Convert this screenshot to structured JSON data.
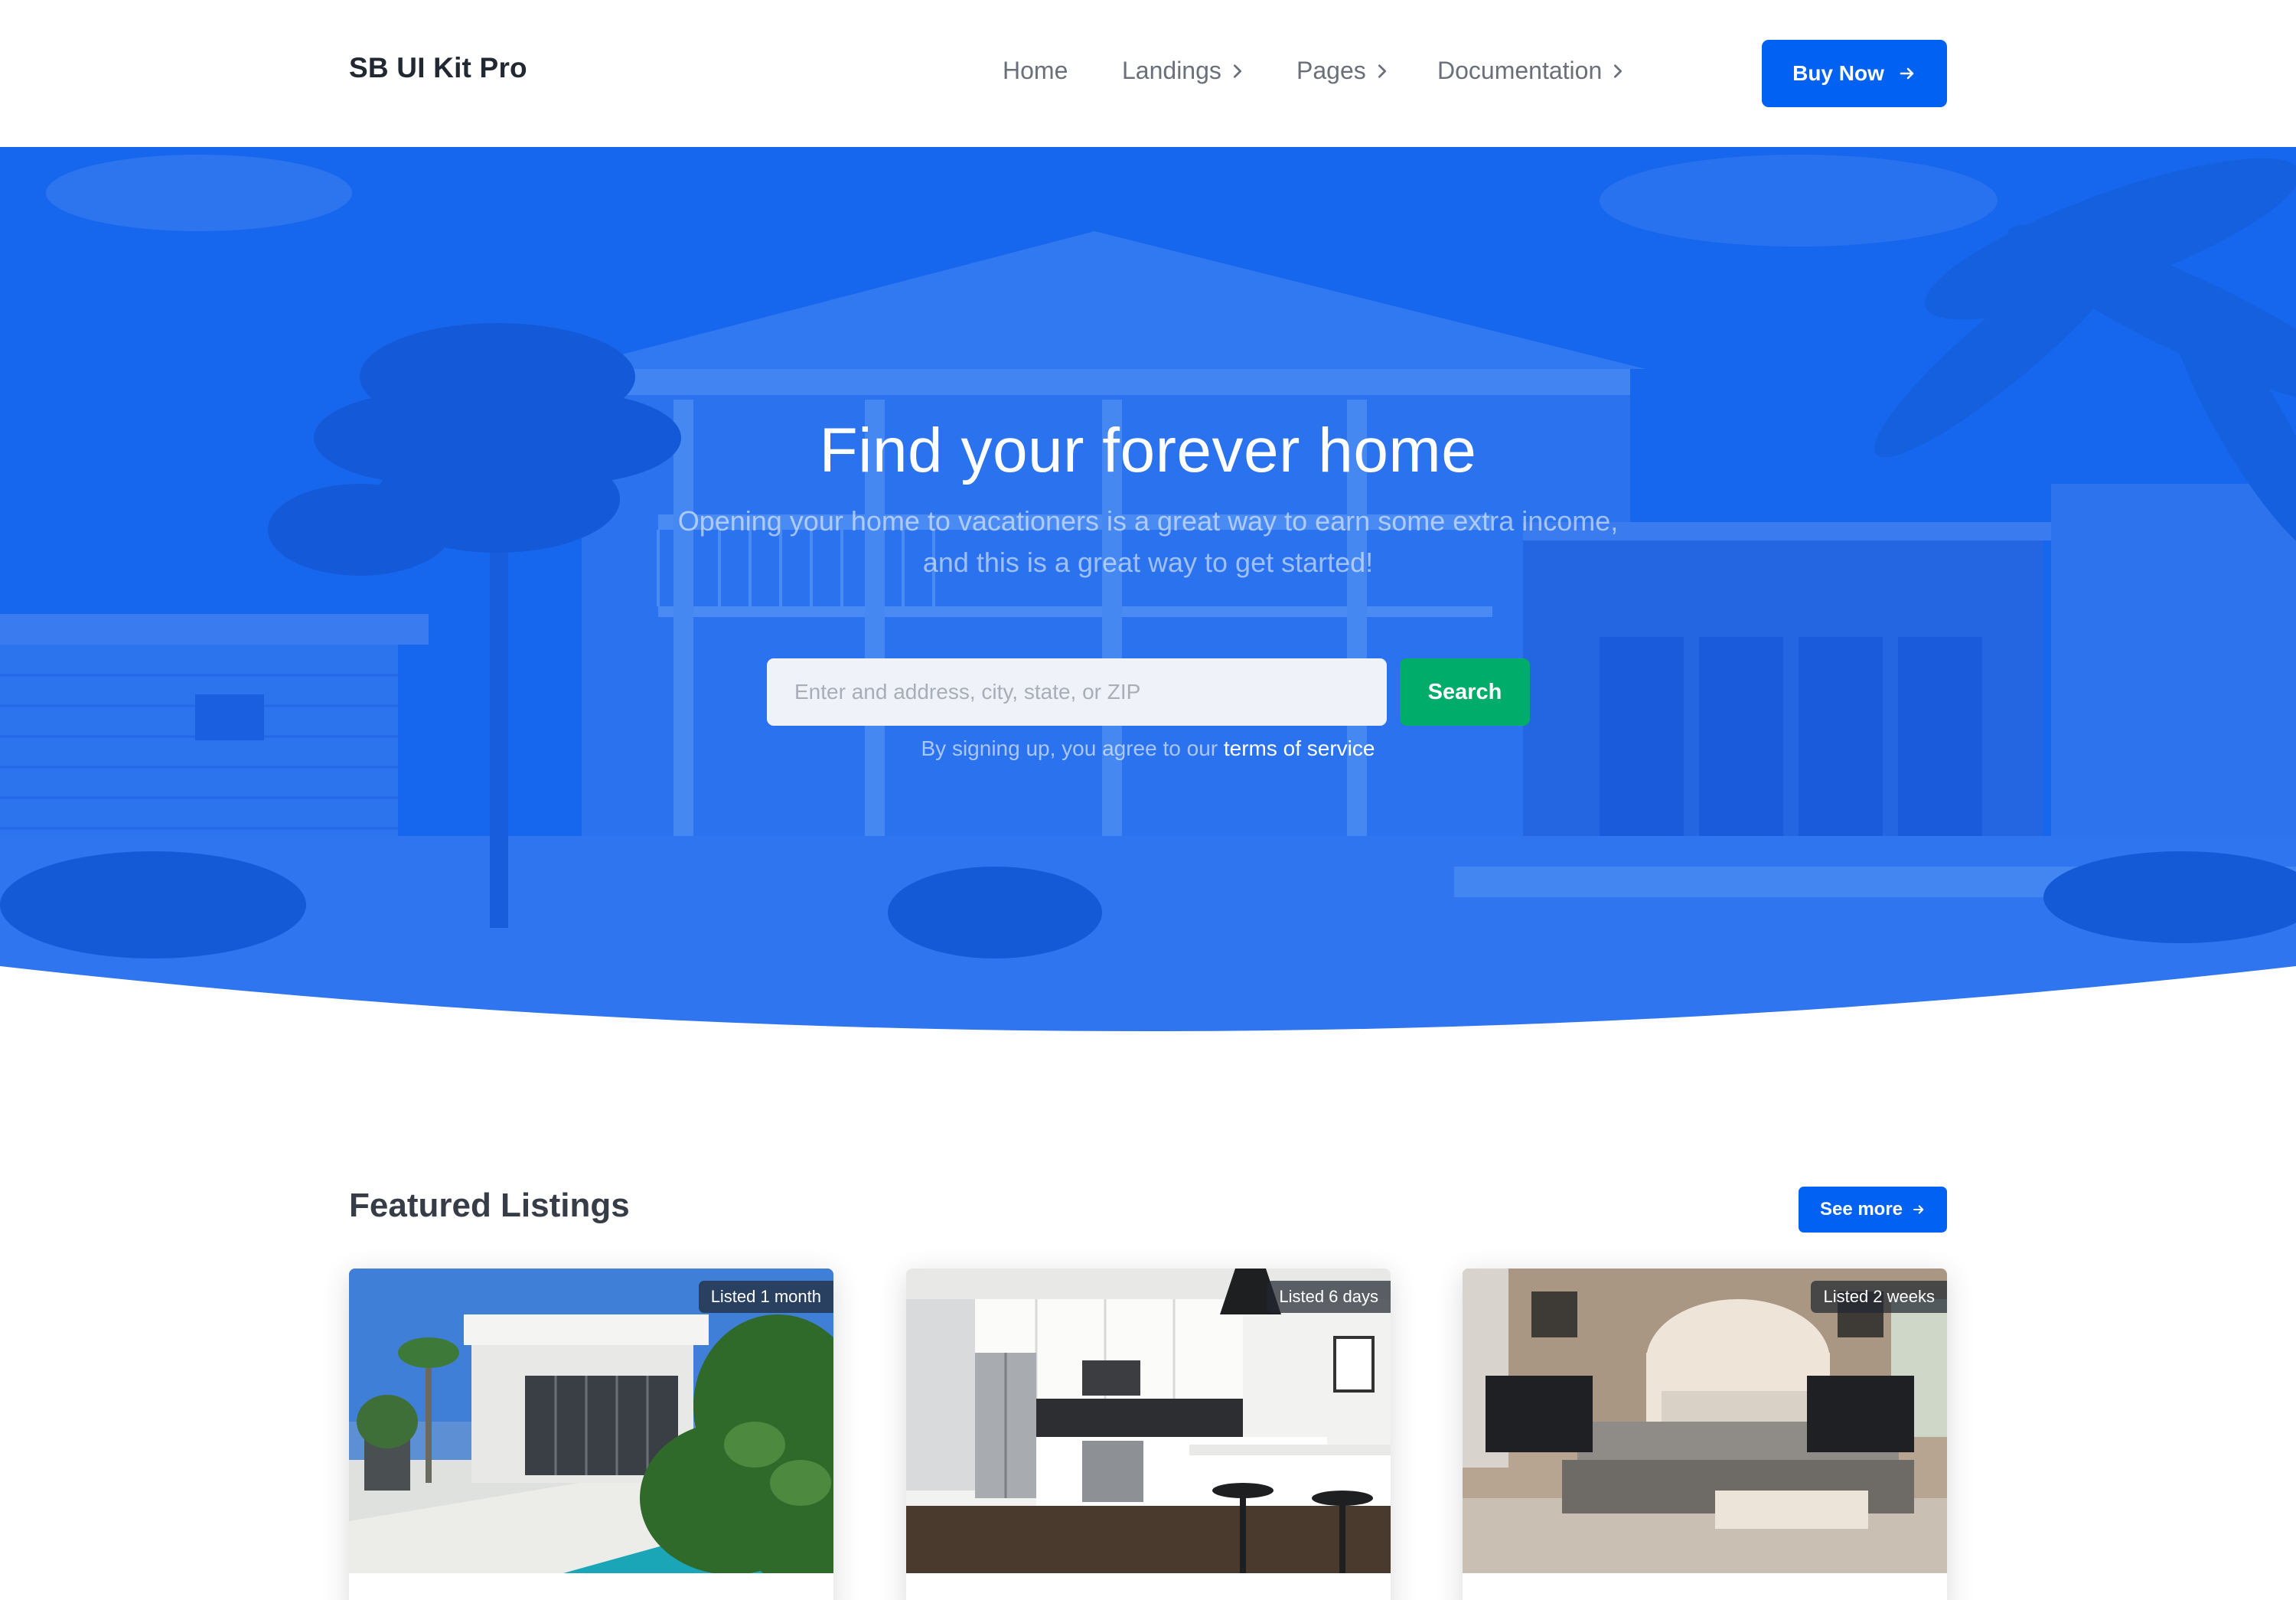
{
  "navbar": {
    "brand": "SB UI Kit Pro",
    "links": [
      {
        "label": "Home",
        "has_chevron": false
      },
      {
        "label": "Landings",
        "has_chevron": true
      },
      {
        "label": "Pages",
        "has_chevron": true
      },
      {
        "label": "Documentation",
        "has_chevron": true
      }
    ],
    "cta_label": "Buy Now",
    "cta_icon": "arrow-right-icon"
  },
  "hero": {
    "title": "Find your forever home",
    "subtitle": "Opening your home to vacationers is a great way to earn some extra income, and this is a great way to get started!",
    "search": {
      "placeholder": "Enter and address, city, state, or ZIP",
      "value": "",
      "button_label": "Search"
    },
    "terms_prefix": "By signing up, you agree to our",
    "terms_link": "terms of service"
  },
  "featured": {
    "title": "Featured Listings",
    "see_more_label": "See more",
    "see_more_icon": "arrow-right-icon",
    "listings": [
      {
        "badge": "Listed 1 month",
        "image": "modern-house-pool-photo"
      },
      {
        "badge": "Listed 6 days",
        "image": "kitchen-photo"
      },
      {
        "badge": "Listed 2 weeks",
        "image": "bedroom-photo"
      }
    ]
  },
  "colors": {
    "primary": "#0061f2",
    "success": "#00ac69",
    "heading": "#212832",
    "muted": "#69707a"
  }
}
